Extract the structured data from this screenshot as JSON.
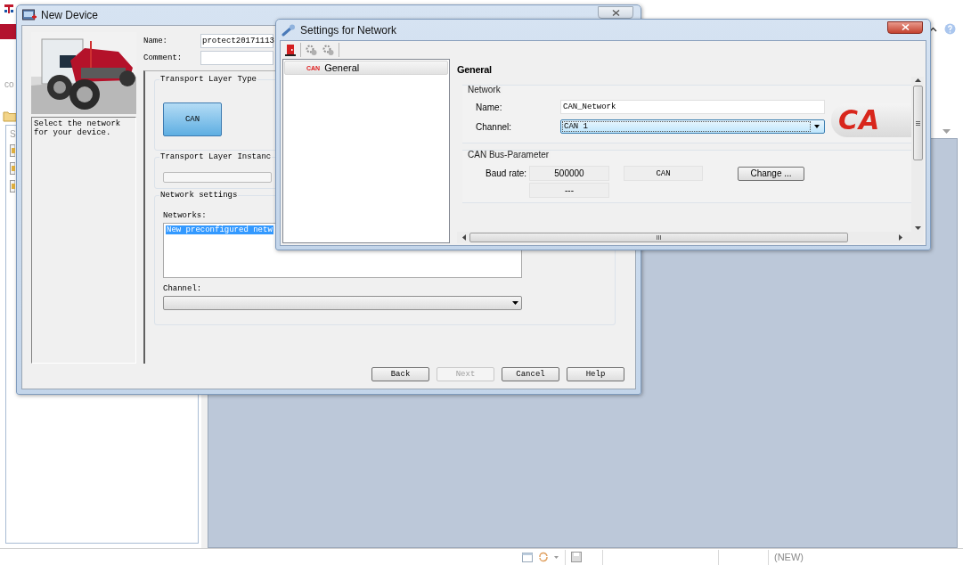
{
  "app": {
    "ribbon_text": "co",
    "panel_text": "S",
    "status_bar": {
      "mode": "(NEW)"
    }
  },
  "new_device": {
    "title": "New Device",
    "description": "Select the network for your device.",
    "name_label": "Name:",
    "name_value": "protect20171113",
    "comment_label": "Comment:",
    "transport_type": {
      "title": "Transport Layer Type",
      "options": [
        {
          "label": "CAN",
          "selected": true
        }
      ]
    },
    "transport_instance": {
      "title": "Transport Layer Instanc"
    },
    "network_settings": {
      "title": "Network settings",
      "networks_label": "Networks:",
      "networks": [
        {
          "label": "New preconfigured netw",
          "selected": true
        }
      ],
      "channel_label": "Channel:"
    },
    "buttons": [
      {
        "label": "Back",
        "disabled": false
      },
      {
        "label": "Next",
        "disabled": true
      },
      {
        "label": "Cancel",
        "disabled": false
      },
      {
        "label": "Help",
        "disabled": false
      }
    ]
  },
  "settings": {
    "title": "Settings for Network",
    "tree": [
      {
        "badge": "CAN",
        "label": "General",
        "selected": true
      }
    ],
    "heading": "General",
    "network": {
      "title": "Network",
      "name_label": "Name:",
      "name_value": "CAN_Network",
      "channel_label": "Channel:",
      "channel_value": "CAN 1",
      "channel_focused": true
    },
    "logo_text": "CA",
    "bus": {
      "title": "CAN Bus-Parameter",
      "baud_label": "Baud rate:",
      "baud_value": "500000",
      "second_value": "---",
      "protocol_value": "CAN",
      "change_button": "Change ..."
    }
  }
}
